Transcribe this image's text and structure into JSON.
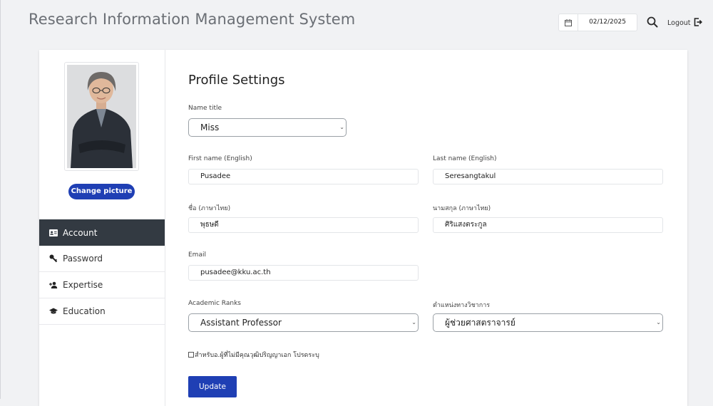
{
  "header": {
    "app_title": "Research Information Management System",
    "date": "02/12/2025",
    "logout_label": "Logout",
    "icons": {
      "calendar": "calendar-icon",
      "search": "search-icon",
      "logout": "logout-icon"
    }
  },
  "sidebar": {
    "change_picture_label": "Change picture",
    "items": [
      {
        "label": "Account",
        "icon": "id-card-icon",
        "active": true
      },
      {
        "label": "Password",
        "icon": "key-icon",
        "active": false
      },
      {
        "label": "Expertise",
        "icon": "user-plus-icon",
        "active": false
      },
      {
        "label": "Education",
        "icon": "graduation-cap-icon",
        "active": false
      }
    ]
  },
  "form": {
    "title": "Profile Settings",
    "name_title": {
      "label": "Name title",
      "value": "Miss"
    },
    "first_name_en": {
      "label": "First name (English)",
      "value": "Pusadee"
    },
    "last_name_en": {
      "label": "Last name (English)",
      "value": "Seresangtakul"
    },
    "first_name_th": {
      "label": "ชื่อ (ภาษาไทย)",
      "value": "พุธษดี"
    },
    "last_name_th": {
      "label": "นามสกุล (ภาษาไทย)",
      "value": "ศิริแสงตระกูล"
    },
    "email": {
      "label": "Email",
      "value": "pusadee@kku.ac.th"
    },
    "academic_rank_en": {
      "label": "Academic Ranks",
      "value": "Assistant Professor"
    },
    "academic_rank_th": {
      "label": "ตำแหน่งทางวิชาการ",
      "value": "ผู้ช่วยศาสตราจารย์"
    },
    "no_doctorate_checkbox": {
      "label": "สำหรับอ.ผู้ที่ไม่มีคุณวุฒิปริญญาเอก โปรดระบุ",
      "checked": false
    },
    "update_label": "Update"
  },
  "colors": {
    "accent": "#1f3fb4",
    "active_nav": "#333a42",
    "page_bg": "#f1f2f4"
  }
}
